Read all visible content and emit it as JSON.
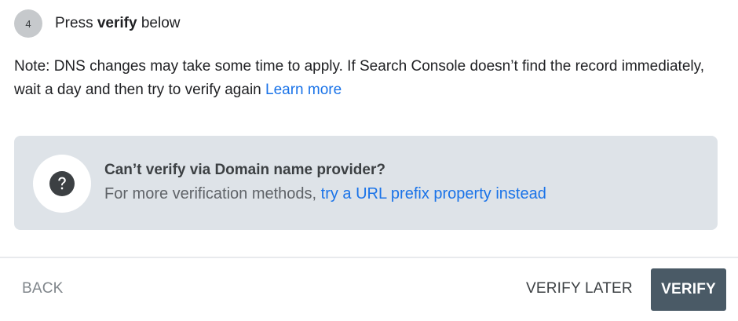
{
  "step": {
    "number": "4",
    "prefix": "Press ",
    "emphasis": "verify",
    "suffix": " below"
  },
  "note": {
    "text": "Note: DNS changes may take some time to apply. If Search Console doesn’t find the record immediately, wait a day and then try to verify again ",
    "link": "Learn more"
  },
  "info": {
    "icon": "help-icon",
    "title": "Can’t verify via Domain name provider?",
    "subtitle_prefix": "For more verification methods, ",
    "subtitle_link": "try a URL prefix property instead"
  },
  "footer": {
    "back_label": "BACK",
    "verify_later_label": "VERIFY LATER",
    "verify_label": "VERIFY"
  },
  "colors": {
    "link": "#1a73e8",
    "info_bg": "#dee3e8",
    "verify_button_bg": "#4a5a66"
  }
}
